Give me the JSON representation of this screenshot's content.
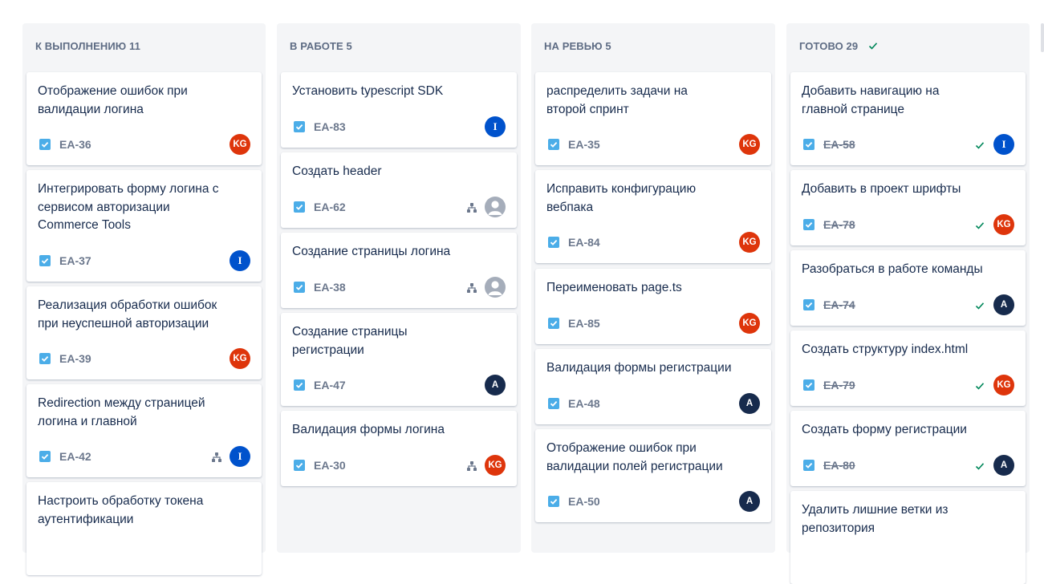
{
  "columns": [
    {
      "title": "К ВЫПОЛНЕНИЮ 11",
      "cards": [
        {
          "summary": "Отображение ошибок при валидации логина",
          "key": "EA-36",
          "avatar": "KG"
        },
        {
          "summary": "Интегрировать форму логина с сервисом авторизации Commerce Tools",
          "key": "EA-37",
          "avatar": "I"
        },
        {
          "summary": "Реализация обработки ошибок при неуспешной авторизации",
          "key": "EA-39",
          "avatar": "KG"
        },
        {
          "summary": "Redirection между страницей логина и главной",
          "key": "EA-42",
          "avatar": "I"
        },
        {
          "summary": "Настроить обработку токена аутентификации",
          "key": "",
          "avatar": ""
        }
      ]
    },
    {
      "title": "В РАБОТЕ 5",
      "cards": [
        {
          "summary": "Установить typescript SDK",
          "key": "EA-83",
          "avatar": "I"
        },
        {
          "summary": "Создать header",
          "key": "EA-62",
          "avatar": ""
        },
        {
          "summary": "Создание страницы логина",
          "key": "EA-38",
          "avatar": ""
        },
        {
          "summary": "Создание страницы регистрации",
          "key": "EA-47",
          "avatar": "A"
        },
        {
          "summary": "Валидация формы логина",
          "key": "EA-30",
          "avatar": "KG"
        }
      ]
    },
    {
      "title": "НА РЕВЬЮ 5",
      "cards": [
        {
          "summary": "распределить задачи на второй спринт",
          "key": "EA-35",
          "avatar": "KG"
        },
        {
          "summary": "Исправить конфигурацию вебпака",
          "key": "EA-84",
          "avatar": "KG"
        },
        {
          "summary": "Переименовать page.ts",
          "key": "EA-85",
          "avatar": "KG"
        },
        {
          "summary": "Валидация формы регистрации",
          "key": "EA-48",
          "avatar": "A"
        },
        {
          "summary": "Отображение ошибок при валидации полей регистрации",
          "key": "EA-50",
          "avatar": "A"
        }
      ]
    },
    {
      "title": "ГОТОВО 29",
      "cards": [
        {
          "summary": "Добавить навигацию на главной странице",
          "key": "EA-58",
          "avatar": "I"
        },
        {
          "summary": "Добавить в проект шрифты",
          "key": "EA-78",
          "avatar": "KG"
        },
        {
          "summary": "Разобраться в работе команды",
          "key": "EA-74",
          "avatar": "A"
        },
        {
          "summary": "Создать структуру index.html",
          "key": "EA-79",
          "avatar": "KG"
        },
        {
          "summary": "Создать форму регистрации",
          "key": "EA-80",
          "avatar": "A"
        },
        {
          "summary": "Удалить лишние ветки из репозитория",
          "key": "",
          "avatar": ""
        }
      ]
    }
  ],
  "colors": {
    "column_bg": "#f4f5f7",
    "story_icon": "#4bade8",
    "avatar_kg": "#de350b",
    "avatar_i": "#0052cc",
    "avatar_a": "#172b4d",
    "done_check": "#00875a"
  },
  "icons": {
    "issue_type": "story-checkbox-icon",
    "subtask": "subtask-hierarchy-icon",
    "unassigned": "user-placeholder-icon",
    "done": "checkmark-icon"
  }
}
